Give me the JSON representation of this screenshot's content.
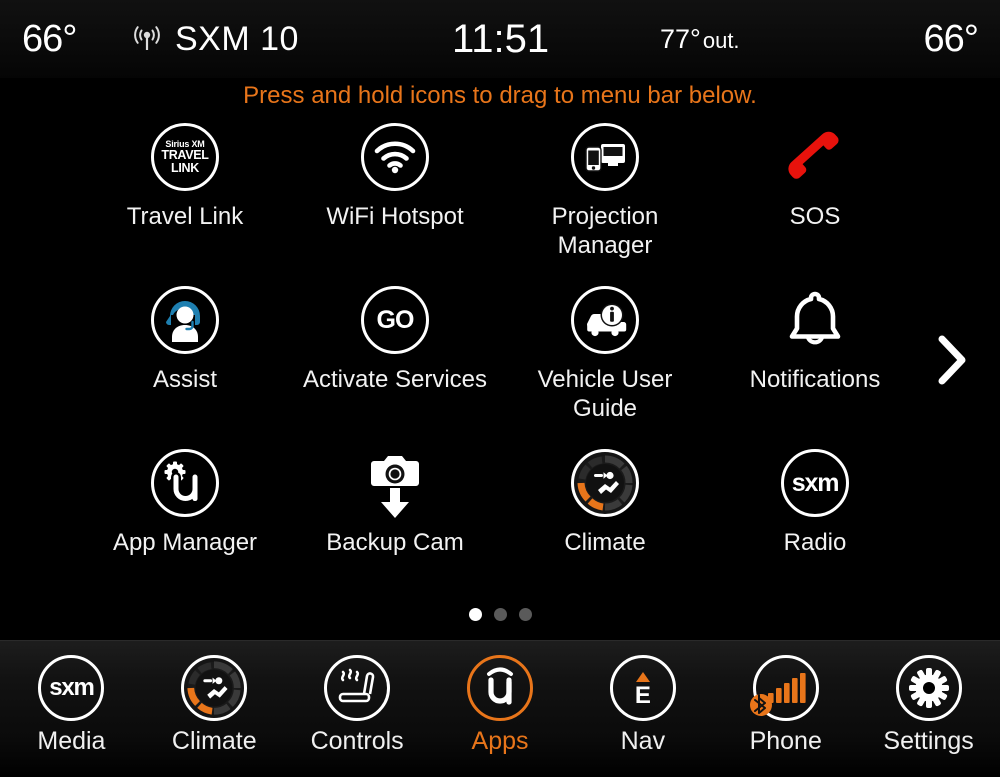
{
  "status_bar": {
    "temp_left": "66°",
    "radio_icon": "broadcast-antenna-icon",
    "source": "SXM 10",
    "clock": "11:51",
    "outside_temp": "77°",
    "outside_suffix": "out.",
    "temp_right": "66°"
  },
  "hint": {
    "text": "Press and hold icons to drag to menu bar below.",
    "color": "#E8751A"
  },
  "apps": [
    {
      "label": "Travel Link",
      "icon": "sirius-xm-travel-link-icon",
      "mark": {
        "line1": "Sirius XM",
        "line2": "TRAVEL",
        "line3": "LINK"
      }
    },
    {
      "label": "WiFi Hotspot",
      "icon": "wifi-icon"
    },
    {
      "label": "Projection\nManager",
      "icon": "projection-phone-screen-icon"
    },
    {
      "label": "SOS",
      "icon": "sos-phone-handset-icon",
      "color": "#E8120C"
    },
    {
      "label": "Assist",
      "icon": "headset-agent-icon",
      "accent": "#1E7FB0"
    },
    {
      "label": "Activate Services",
      "icon": "go-icon",
      "mark": {
        "text": "GO"
      }
    },
    {
      "label": "Vehicle User\nGuide",
      "icon": "car-info-icon"
    },
    {
      "label": "Notifications",
      "icon": "bell-icon"
    },
    {
      "label": "App Manager",
      "icon": "uconnect-gear-icon"
    },
    {
      "label": "Backup Cam",
      "icon": "camera-down-arrow-icon"
    },
    {
      "label": "Climate",
      "icon": "climate-dial-icon",
      "accent": "#E8751A"
    },
    {
      "label": "Radio",
      "icon": "sxm-icon",
      "mark": {
        "text": "sxm"
      }
    }
  ],
  "next_page": {
    "icon": "chevron-right-icon"
  },
  "page_dots": {
    "count": 3,
    "active_index": 0
  },
  "menu_bar": {
    "items": [
      {
        "label": "Media",
        "icon": "sxm-icon",
        "mark": "sxm",
        "active": false
      },
      {
        "label": "Climate",
        "icon": "climate-dial-icon",
        "active": false
      },
      {
        "label": "Controls",
        "icon": "heated-seat-icon",
        "active": false
      },
      {
        "label": "Apps",
        "icon": "uconnect-u-icon",
        "active": true
      },
      {
        "label": "Nav",
        "icon": "compass-east-icon",
        "mark": "E",
        "active": false
      },
      {
        "label": "Phone",
        "icon": "signal-bars-bluetooth-icon",
        "active": false
      },
      {
        "label": "Settings",
        "icon": "gear-icon",
        "active": false
      }
    ],
    "accent": "#E8751A"
  }
}
